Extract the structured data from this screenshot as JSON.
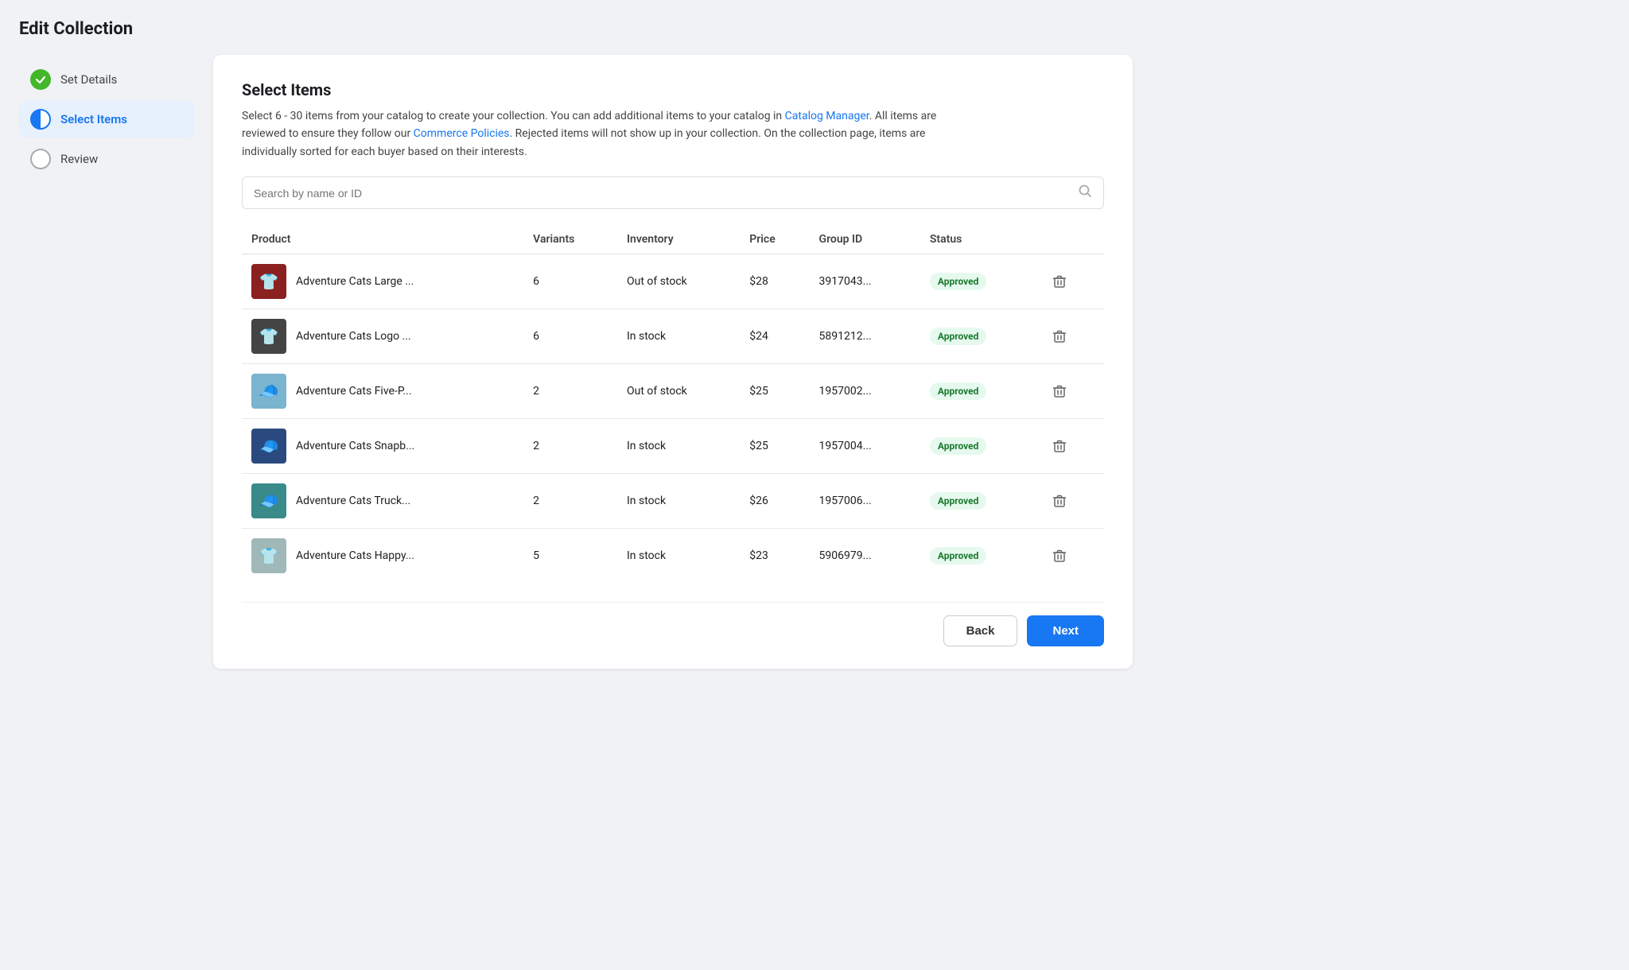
{
  "page": {
    "title": "Edit Collection"
  },
  "sidebar": {
    "steps": [
      {
        "id": "set-details",
        "label": "Set Details",
        "state": "completed"
      },
      {
        "id": "select-items",
        "label": "Select Items",
        "state": "active"
      },
      {
        "id": "review",
        "label": "Review",
        "state": "pending"
      }
    ]
  },
  "main": {
    "section_title": "Select Items",
    "description_part1": "Select 6 - 30 items from your catalog to create your collection. You can add additional items to your catalog in ",
    "link1_text": "Catalog Manager",
    "description_part2": ". All items are reviewed to ensure they follow our ",
    "link2_text": "Commerce Policies",
    "description_part3": ". Rejected items will not show up in your collection. On the collection page, items are individually sorted for each buyer based on their interests.",
    "search_placeholder": "Search by name or ID",
    "table": {
      "columns": [
        "Product",
        "Variants",
        "Inventory",
        "Price",
        "Group ID",
        "Status"
      ],
      "rows": [
        {
          "id": "row-1",
          "product_name": "Adventure Cats Large ...",
          "thumb_color": "#8b2020",
          "thumb_icon": "👕",
          "variants": "6",
          "inventory": "Out of stock",
          "price": "$28",
          "group_id": "3917043...",
          "status": "Approved"
        },
        {
          "id": "row-2",
          "product_name": "Adventure Cats Logo ...",
          "thumb_color": "#444",
          "thumb_icon": "👕",
          "variants": "6",
          "inventory": "In stock",
          "price": "$24",
          "group_id": "5891212...",
          "status": "Approved"
        },
        {
          "id": "row-3",
          "product_name": "Adventure Cats Five-P...",
          "thumb_color": "#7ab4ce",
          "thumb_icon": "🧢",
          "variants": "2",
          "inventory": "Out of stock",
          "price": "$25",
          "group_id": "1957002...",
          "status": "Approved"
        },
        {
          "id": "row-4",
          "product_name": "Adventure Cats Snapb...",
          "thumb_color": "#2a4a7f",
          "thumb_icon": "🧢",
          "variants": "2",
          "inventory": "In stock",
          "price": "$25",
          "group_id": "1957004...",
          "status": "Approved"
        },
        {
          "id": "row-5",
          "product_name": "Adventure Cats Truck...",
          "thumb_color": "#3a8a8a",
          "thumb_icon": "🧢",
          "variants": "2",
          "inventory": "In stock",
          "price": "$26",
          "group_id": "1957006...",
          "status": "Approved"
        },
        {
          "id": "row-6",
          "product_name": "Adventure Cats Happy...",
          "thumb_color": "#a0b8b8",
          "thumb_icon": "👕",
          "variants": "5",
          "inventory": "In stock",
          "price": "$23",
          "group_id": "5906979...",
          "status": "Approved"
        }
      ]
    },
    "footer": {
      "back_label": "Back",
      "next_label": "Next"
    }
  }
}
